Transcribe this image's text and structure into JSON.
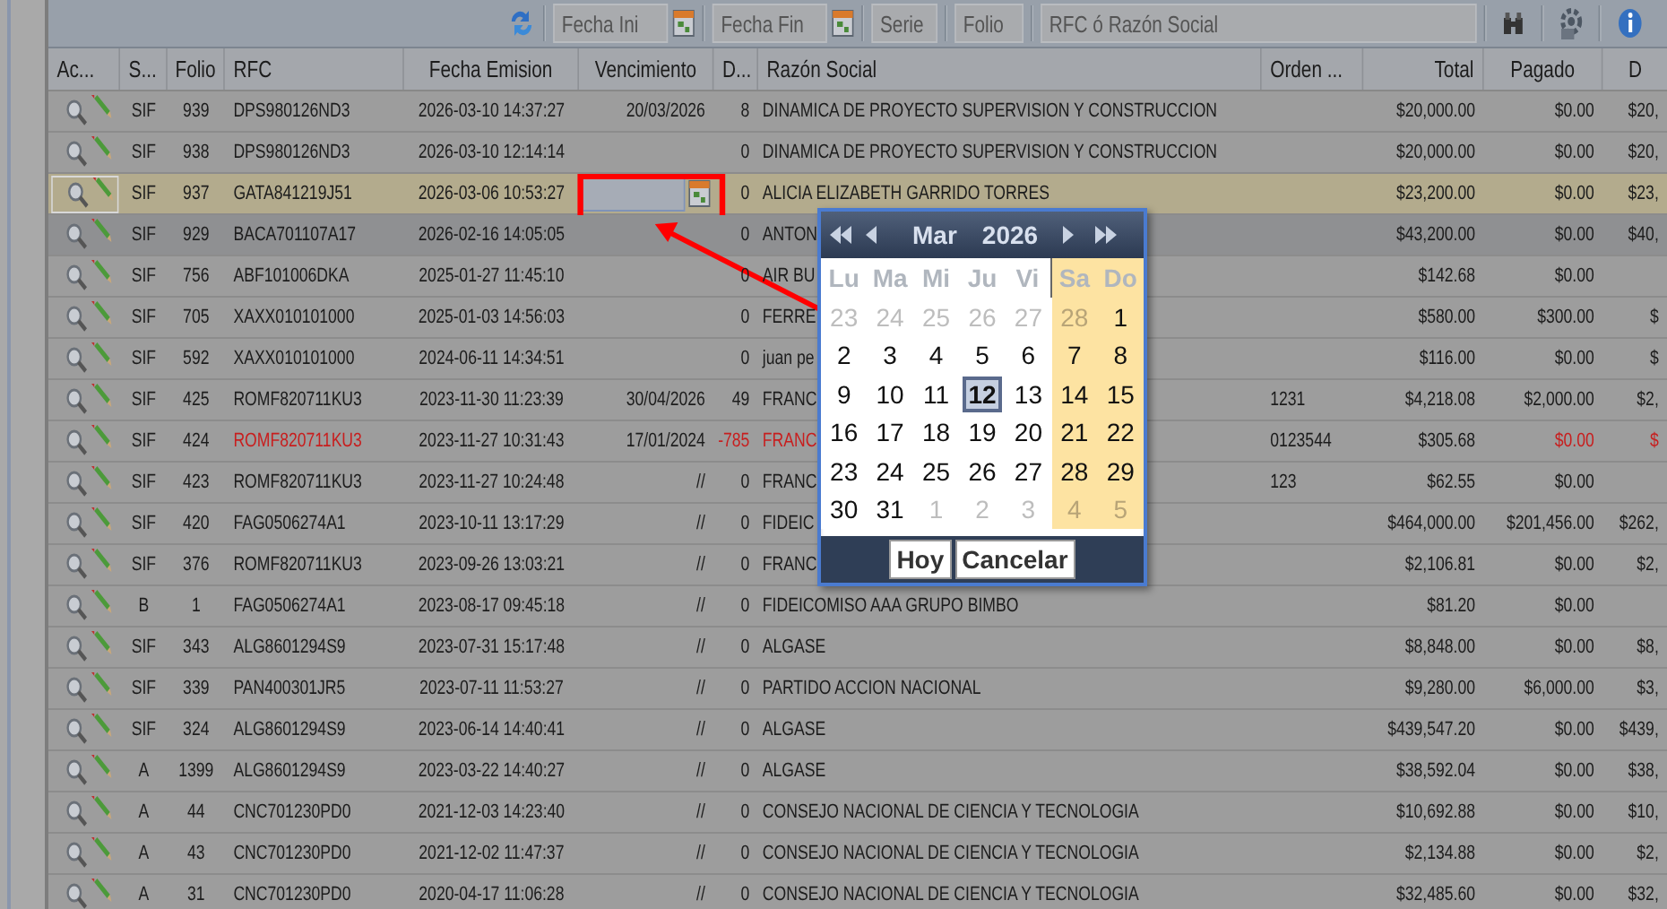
{
  "toolbar": {
    "fields": [
      {
        "kind": "date",
        "placeholder": "Fecha Ini"
      },
      {
        "kind": "date",
        "placeholder": "Fecha Fin"
      },
      {
        "kind": "text",
        "placeholder": "Serie"
      },
      {
        "kind": "text",
        "placeholder": "Folio"
      },
      {
        "kind": "text",
        "placeholder": "RFC ó Razón Social"
      }
    ]
  },
  "table": {
    "columns": [
      "Ac...",
      "S...",
      "Folio",
      "RFC",
      "Fecha Emision",
      "Vencimiento",
      "D...",
      "Razón Social",
      "Orden ...",
      "Total",
      "Pagado",
      "D"
    ],
    "rows": [
      {
        "selected": false,
        "hovered": false,
        "overdue": false,
        "editing": false,
        "serie": "SIF",
        "folio": "939",
        "rfc": "DPS980126ND3",
        "fecha_emision": "2026-03-10 14:37:27",
        "vencimiento": "20/03/2026",
        "dias": "8",
        "razon_social": "DINAMICA DE PROYECTO SUPERVISION Y CONSTRUCCION",
        "total": "$20,000.00",
        "pagado": "$0.00",
        "column_12": "$20,"
      },
      {
        "selected": false,
        "hovered": false,
        "overdue": false,
        "editing": false,
        "serie": "SIF",
        "folio": "938",
        "rfc": "DPS980126ND3",
        "fecha_emision": "2026-03-10 12:14:14",
        "dias": "0",
        "razon_social": "DINAMICA DE PROYECTO SUPERVISION Y CONSTRUCCION",
        "total": "$20,000.00",
        "pagado": "$0.00",
        "column_12": "$20,"
      },
      {
        "selected": true,
        "hovered": false,
        "overdue": false,
        "editing": true,
        "serie": "SIF",
        "folio": "937",
        "rfc": "GATA841219J51",
        "fecha_emision": "2026-03-06 10:53:27",
        "dias": "0",
        "razon_social": "ALICIA ELIZABETH GARRIDO TORRES",
        "total": "$23,200.00",
        "pagado": "$0.00",
        "column_12": "$23,"
      },
      {
        "selected": false,
        "hovered": true,
        "overdue": false,
        "editing": false,
        "serie": "SIF",
        "folio": "929",
        "rfc": "BACA701107A17",
        "fecha_emision": "2026-02-16 14:05:05",
        "dias": "0",
        "razon_social": "ANTON",
        "total": "$43,200.00",
        "pagado": "$0.00",
        "column_12": "$40,"
      },
      {
        "selected": false,
        "hovered": false,
        "overdue": false,
        "editing": false,
        "serie": "SIF",
        "folio": "756",
        "rfc": "ABF101006DKA",
        "fecha_emision": "2025-01-27 11:45:10",
        "dias": "0",
        "razon_social": "AIR BU",
        "total": "$142.68",
        "pagado": "$0.00"
      },
      {
        "selected": false,
        "hovered": false,
        "overdue": false,
        "editing": false,
        "serie": "SIF",
        "folio": "705",
        "rfc": "XAXX010101000",
        "fecha_emision": "2025-01-03 14:56:03",
        "dias": "0",
        "razon_social": "FERRE",
        "total": "$580.00",
        "pagado": "$300.00",
        "column_12": "$"
      },
      {
        "selected": false,
        "hovered": false,
        "overdue": false,
        "editing": false,
        "serie": "SIF",
        "folio": "592",
        "rfc": "XAXX010101000",
        "fecha_emision": "2024-06-11 14:34:51",
        "dias": "0",
        "razon_social": "juan pe",
        "total": "$116.00",
        "pagado": "$0.00",
        "column_12": "$"
      },
      {
        "selected": false,
        "hovered": false,
        "overdue": false,
        "editing": false,
        "serie": "SIF",
        "folio": "425",
        "rfc": "ROMF820711KU3",
        "fecha_emision": "2023-11-30 11:23:39",
        "vencimiento": "30/04/2026",
        "dias": "49",
        "razon_social": "FRANC",
        "orden": "1231",
        "total": "$4,218.08",
        "pagado": "$2,000.00",
        "column_12": "$2,"
      },
      {
        "selected": false,
        "hovered": false,
        "overdue": true,
        "editing": false,
        "serie": "SIF",
        "folio": "424",
        "rfc": "ROMF820711KU3",
        "fecha_emision": "2023-11-27 10:31:43",
        "vencimiento": "17/01/2024",
        "dias": "-785",
        "razon_social": "FRANC",
        "orden": "0123544",
        "total": "$305.68",
        "pagado": "$0.00",
        "column_12": "$"
      },
      {
        "selected": false,
        "hovered": false,
        "overdue": false,
        "editing": false,
        "serie": "SIF",
        "folio": "423",
        "rfc": "ROMF820711KU3",
        "fecha_emision": "2023-11-27 10:24:48",
        "vencimiento": "//",
        "dias": "0",
        "razon_social": "FRANC",
        "orden": "123",
        "total": "$62.55",
        "pagado": "$0.00"
      },
      {
        "selected": false,
        "hovered": false,
        "overdue": false,
        "editing": false,
        "serie": "SIF",
        "folio": "420",
        "rfc": "FAG0506274A1",
        "fecha_emision": "2023-10-11 13:17:29",
        "vencimiento": "//",
        "dias": "0",
        "razon_social": "FIDEIC",
        "total": "$464,000.00",
        "pagado": "$201,456.00",
        "column_12": "$262,"
      },
      {
        "selected": false,
        "hovered": false,
        "overdue": false,
        "editing": false,
        "serie": "SIF",
        "folio": "376",
        "rfc": "ROMF820711KU3",
        "fecha_emision": "2023-09-26 13:03:21",
        "vencimiento": "//",
        "dias": "0",
        "razon_social": "FRANC",
        "total": "$2,106.81",
        "pagado": "$0.00",
        "column_12": "$2,"
      },
      {
        "selected": false,
        "hovered": false,
        "overdue": false,
        "editing": false,
        "serie": "B",
        "folio": "1",
        "rfc": "FAG0506274A1",
        "fecha_emision": "2023-08-17 09:45:18",
        "vencimiento": "//",
        "dias": "0",
        "razon_social": "FIDEICOMISO AAA GRUPO BIMBO",
        "total": "$81.20",
        "pagado": "$0.00"
      },
      {
        "selected": false,
        "hovered": false,
        "overdue": false,
        "editing": false,
        "serie": "SIF",
        "folio": "343",
        "rfc": "ALG8601294S9",
        "fecha_emision": "2023-07-31 15:17:48",
        "vencimiento": "//",
        "dias": "0",
        "razon_social": "ALGASE",
        "total": "$8,848.00",
        "pagado": "$0.00",
        "column_12": "$8,"
      },
      {
        "selected": false,
        "hovered": false,
        "overdue": false,
        "editing": false,
        "serie": "SIF",
        "folio": "339",
        "rfc": "PAN400301JR5",
        "fecha_emision": "2023-07-11 11:53:27",
        "vencimiento": "//",
        "dias": "0",
        "razon_social": "PARTIDO ACCION NACIONAL",
        "total": "$9,280.00",
        "pagado": "$6,000.00",
        "column_12": "$3,"
      },
      {
        "selected": false,
        "hovered": false,
        "overdue": false,
        "editing": false,
        "serie": "SIF",
        "folio": "324",
        "rfc": "ALG8601294S9",
        "fecha_emision": "2023-06-14 14:40:41",
        "vencimiento": "//",
        "dias": "0",
        "razon_social": "ALGASE",
        "total": "$439,547.20",
        "pagado": "$0.00",
        "column_12": "$439,"
      },
      {
        "selected": false,
        "hovered": false,
        "overdue": false,
        "editing": false,
        "serie": "A",
        "folio": "1399",
        "rfc": "ALG8601294S9",
        "fecha_emision": "2023-03-22 14:40:27",
        "vencimiento": "//",
        "dias": "0",
        "razon_social": "ALGASE",
        "total": "$38,592.04",
        "pagado": "$0.00",
        "column_12": "$38,"
      },
      {
        "selected": false,
        "hovered": false,
        "overdue": false,
        "editing": false,
        "serie": "A",
        "folio": "44",
        "rfc": "CNC701230PD0",
        "fecha_emision": "2021-12-03 14:23:40",
        "vencimiento": "//",
        "dias": "0",
        "razon_social": "CONSEJO NACIONAL DE CIENCIA Y TECNOLOGIA",
        "total": "$10,692.88",
        "pagado": "$0.00",
        "column_12": "$10,"
      },
      {
        "selected": false,
        "hovered": false,
        "overdue": false,
        "editing": false,
        "serie": "A",
        "folio": "43",
        "rfc": "CNC701230PD0",
        "fecha_emision": "2021-12-02 11:47:37",
        "vencimiento": "//",
        "dias": "0",
        "razon_social": "CONSEJO NACIONAL DE CIENCIA Y TECNOLOGIA",
        "total": "$2,134.88",
        "pagado": "$0.00",
        "column_12": "$2,"
      },
      {
        "selected": false,
        "hovered": false,
        "overdue": false,
        "editing": false,
        "serie": "A",
        "folio": "31",
        "rfc": "CNC701230PD0",
        "fecha_emision": "2020-04-17 11:06:28",
        "vencimiento": "//",
        "dias": "0",
        "razon_social": "CONSEJO NACIONAL DE CIENCIA Y TECNOLOGIA",
        "total": "$32,485.60",
        "pagado": "$0.00",
        "column_12": "$32,"
      }
    ]
  },
  "calendar": {
    "month": "Mar",
    "year": "2026",
    "weekdays": [
      {
        "label": "Lu",
        "weekend": false
      },
      {
        "label": "Ma",
        "weekend": false
      },
      {
        "label": "Mi",
        "weekend": false
      },
      {
        "label": "Ju",
        "weekend": false
      },
      {
        "label": "Vi",
        "weekend": false
      },
      {
        "label": "Sa",
        "weekend": true
      },
      {
        "label": "Do",
        "weekend": true
      }
    ],
    "weeks": [
      {
        "days": [
          {
            "day": "23",
            "outside": true,
            "selected": false
          },
          {
            "day": "24",
            "outside": true,
            "selected": false
          },
          {
            "day": "25",
            "outside": true,
            "selected": false
          },
          {
            "day": "26",
            "outside": true,
            "selected": false
          },
          {
            "day": "27",
            "outside": true,
            "selected": false
          },
          {
            "day": "28",
            "outside": true,
            "selected": false
          },
          {
            "day": "1",
            "outside": false,
            "selected": false
          }
        ]
      },
      {
        "days": [
          {
            "day": "2",
            "outside": false,
            "selected": false
          },
          {
            "day": "3",
            "outside": false,
            "selected": false
          },
          {
            "day": "4",
            "outside": false,
            "selected": false
          },
          {
            "day": "5",
            "outside": false,
            "selected": false
          },
          {
            "day": "6",
            "outside": false,
            "selected": false
          },
          {
            "day": "7",
            "outside": false,
            "selected": false
          },
          {
            "day": "8",
            "outside": false,
            "selected": false
          }
        ]
      },
      {
        "days": [
          {
            "day": "9",
            "outside": false,
            "selected": false
          },
          {
            "day": "10",
            "outside": false,
            "selected": false
          },
          {
            "day": "11",
            "outside": false,
            "selected": false
          },
          {
            "day": "12",
            "outside": false,
            "selected": true
          },
          {
            "day": "13",
            "outside": false,
            "selected": false
          },
          {
            "day": "14",
            "outside": false,
            "selected": false
          },
          {
            "day": "15",
            "outside": false,
            "selected": false
          }
        ]
      },
      {
        "days": [
          {
            "day": "16",
            "outside": false,
            "selected": false
          },
          {
            "day": "17",
            "outside": false,
            "selected": false
          },
          {
            "day": "18",
            "outside": false,
            "selected": false
          },
          {
            "day": "19",
            "outside": false,
            "selected": false
          },
          {
            "day": "20",
            "outside": false,
            "selected": false
          },
          {
            "day": "21",
            "outside": false,
            "selected": false
          },
          {
            "day": "22",
            "outside": false,
            "selected": false
          }
        ]
      },
      {
        "days": [
          {
            "day": "23",
            "outside": false,
            "selected": false
          },
          {
            "day": "24",
            "outside": false,
            "selected": false
          },
          {
            "day": "25",
            "outside": false,
            "selected": false
          },
          {
            "day": "26",
            "outside": false,
            "selected": false
          },
          {
            "day": "27",
            "outside": false,
            "selected": false
          },
          {
            "day": "28",
            "outside": false,
            "selected": false
          },
          {
            "day": "29",
            "outside": false,
            "selected": false
          }
        ]
      },
      {
        "days": [
          {
            "day": "30",
            "outside": false,
            "selected": false
          },
          {
            "day": "31",
            "outside": false,
            "selected": false
          },
          {
            "day": "1",
            "outside": true,
            "selected": false
          },
          {
            "day": "2",
            "outside": true,
            "selected": false
          },
          {
            "day": "3",
            "outside": true,
            "selected": false
          },
          {
            "day": "4",
            "outside": true,
            "selected": false
          },
          {
            "day": "5",
            "outside": true,
            "selected": false
          }
        ]
      }
    ],
    "buttons": [
      "Hoy",
      "Cancelar"
    ]
  }
}
